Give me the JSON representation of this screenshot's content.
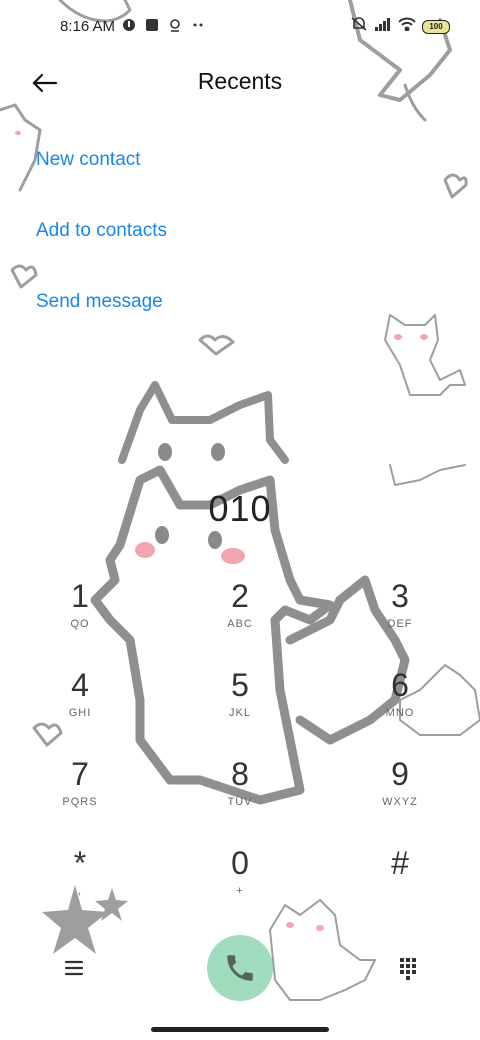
{
  "status_bar": {
    "time": "8:16 AM",
    "battery": "100",
    "icons": [
      "notification-icon",
      "app-square-icon",
      "location-icon",
      "more-dots-icon",
      "mute-icon",
      "signal-icon",
      "wifi-icon",
      "battery-icon"
    ]
  },
  "header": {
    "title": "Recents",
    "back_icon": "arrow-left-icon"
  },
  "actions": [
    {
      "label": "New contact"
    },
    {
      "label": "Add to contacts"
    },
    {
      "label": "Send message"
    }
  ],
  "dialed_number": "010",
  "keypad": [
    {
      "digit": "1",
      "letters": "QO"
    },
    {
      "digit": "2",
      "letters": "ABC"
    },
    {
      "digit": "3",
      "letters": "DEF"
    },
    {
      "digit": "4",
      "letters": "GHI"
    },
    {
      "digit": "5",
      "letters": "JKL"
    },
    {
      "digit": "6",
      "letters": "MNO"
    },
    {
      "digit": "7",
      "letters": "PQRS"
    },
    {
      "digit": "8",
      "letters": "TUV"
    },
    {
      "digit": "9",
      "letters": "WXYZ"
    },
    {
      "digit": "*",
      "letters": ","
    },
    {
      "digit": "0",
      "letters": "+"
    },
    {
      "digit": "#",
      "letters": ""
    }
  ],
  "bottom_bar": {
    "menu_icon": "menu-lines-icon",
    "call_icon": "phone-icon",
    "keypad_icon": "dialpad-icon",
    "call_color": "#7fcfa6"
  },
  "theme": {
    "accent": "#1a86e6",
    "background": "#ffffff"
  }
}
